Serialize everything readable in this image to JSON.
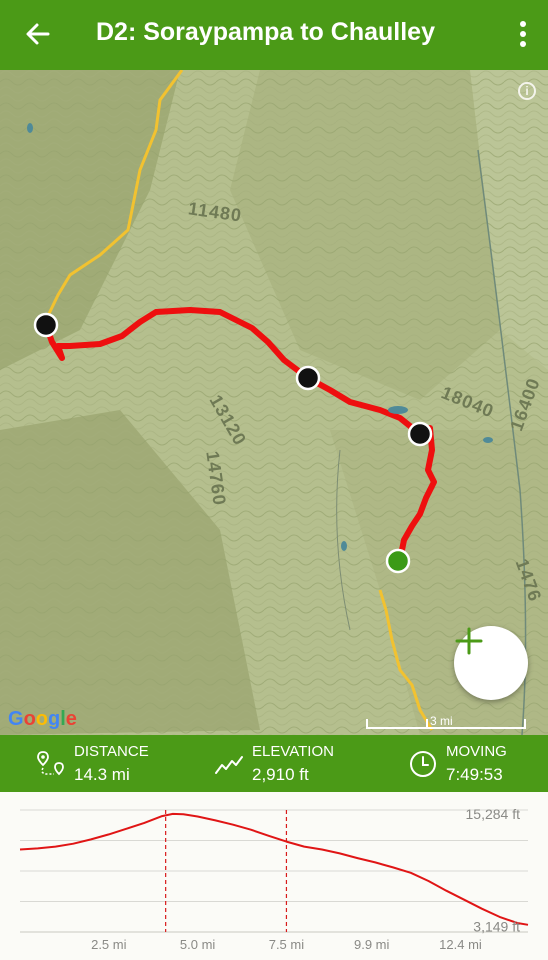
{
  "header": {
    "title": "D2: Soraypampa to Chaulley",
    "back_icon": "arrow-left-icon",
    "menu_icon": "more-vertical-icon"
  },
  "map": {
    "contour_labels": [
      "11480",
      "13120",
      "14760",
      "18040",
      "16400",
      "1476"
    ],
    "google_logo": "Google",
    "scale_label": "3 mi",
    "zoom_icon": "plus-icon",
    "info_icon": "info-icon",
    "route_color": "#ee0f0f",
    "trail_color": "#f2c230",
    "start_marker_color": "#3b9a16",
    "waypoint_color": "#111111"
  },
  "stats": {
    "distance": {
      "label": "DISTANCE",
      "value": "14.3 mi",
      "icon": "route-pin-icon"
    },
    "elevation": {
      "label": "ELEVATION",
      "value": "2,910 ft",
      "icon": "elevation-trend-icon"
    },
    "moving": {
      "label": "MOVING",
      "value": "7:49:53",
      "icon": "clock-icon"
    }
  },
  "chart_data": {
    "type": "line",
    "xlabel": "",
    "ylabel": "",
    "x_tick_labels": [
      "2.5 mi",
      "5.0 mi",
      "7.5 mi",
      "9.9 mi",
      "12.4 mi"
    ],
    "x_ticks": [
      2.5,
      5.0,
      7.5,
      9.9,
      12.4
    ],
    "y_tick_labels": [
      "15,284 ft",
      "3,149 ft"
    ],
    "y_ticks": [
      15284,
      12149
    ],
    "xlim": [
      0,
      14.3
    ],
    "ylim": [
      12000,
      15400
    ],
    "markers_x": [
      4.1,
      7.5
    ],
    "series": [
      {
        "x": [
          0,
          0.5,
          1.0,
          1.5,
          2.0,
          2.5,
          3.0,
          3.5,
          4.0,
          4.3,
          4.6,
          5.0,
          5.5,
          6.0,
          6.5,
          7.0,
          7.5,
          8.0,
          8.5,
          9.0,
          9.5,
          10.0,
          10.5,
          11.0,
          11.5,
          12.0,
          12.5,
          13.0,
          13.5,
          14.0,
          14.3
        ],
        "y": [
          14300,
          14330,
          14380,
          14460,
          14580,
          14720,
          14880,
          15040,
          15230,
          15290,
          15280,
          15220,
          15110,
          14990,
          14850,
          14680,
          14520,
          14380,
          14300,
          14190,
          14060,
          13940,
          13800,
          13650,
          13420,
          13150,
          12900,
          12650,
          12420,
          12250,
          12200
        ]
      }
    ]
  }
}
